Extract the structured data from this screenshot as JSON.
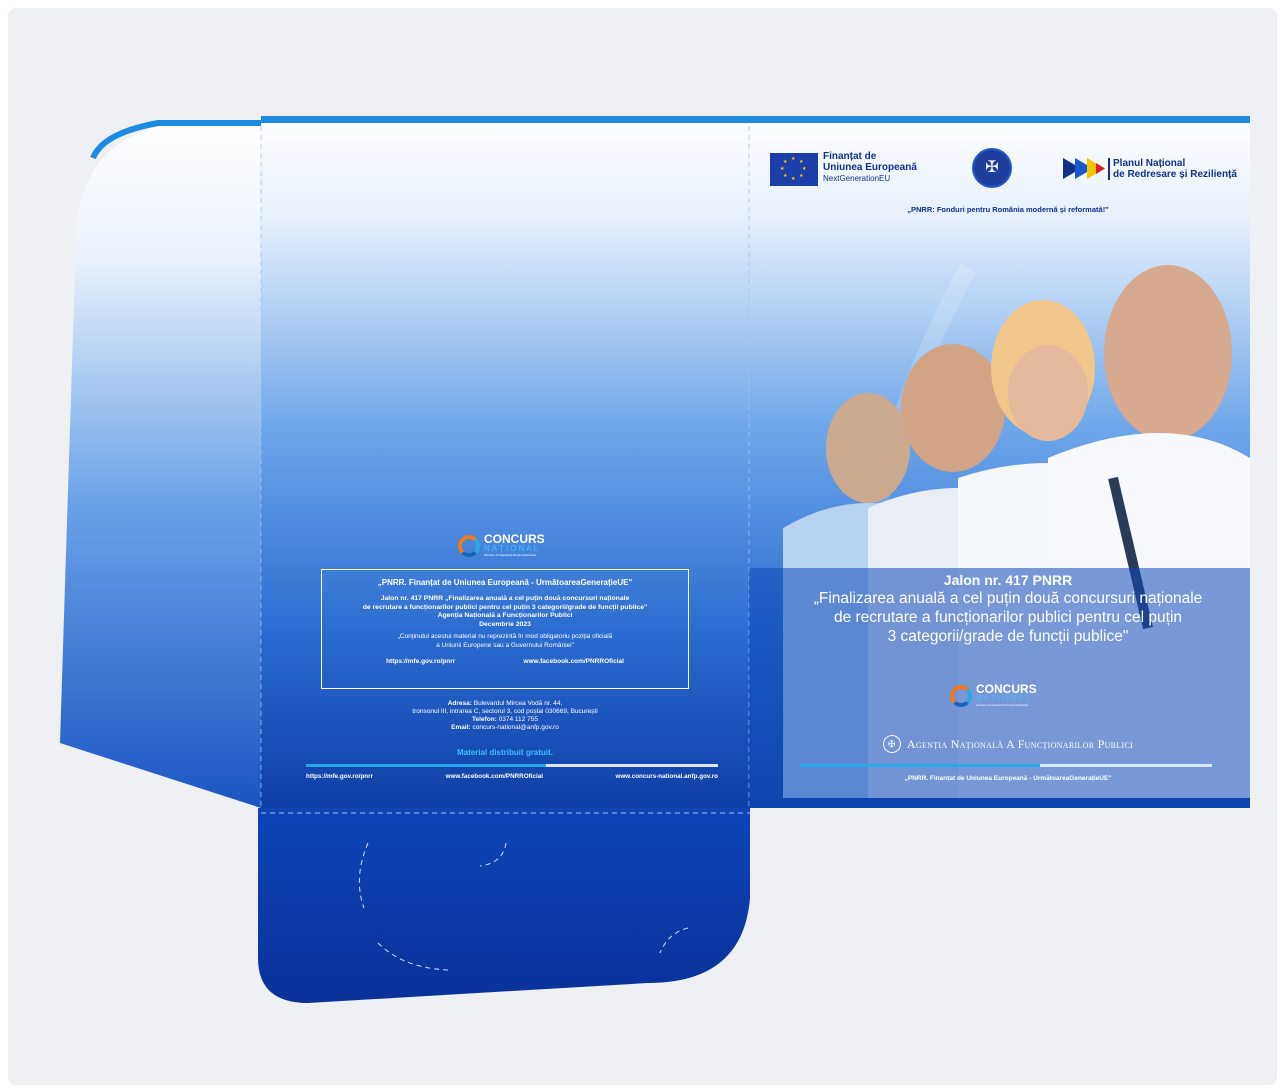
{
  "colors": {
    "background": "#eef0f3",
    "folder_top": "#ffffff",
    "folder_mid": "#4b8de0",
    "folder_bottom": "#0a3aa0",
    "accent_light": "#3fc1ff",
    "accent_dark": "#10308a"
  },
  "header": {
    "eu_line1": "Finanțat de",
    "eu_line2": "Uniunea Europeană",
    "eu_line3": "NextGenerationEU",
    "gov_seal_icon": "romanian-government-seal",
    "pnrr_line1": "Planul Național",
    "pnrr_line2": "de Redresare și Reziliență",
    "slogan": "„PNRR: Fonduri pentru România modernă și reformată!\""
  },
  "cover": {
    "title": "Jalon nr. 417 PNRR",
    "subtitle_line1": "„Finalizarea anuală a cel puțin două concursuri naționale",
    "subtitle_line2": "de recrutare a funcționarilor publici pentru cel puțin",
    "subtitle_line3": "3 categorii/grade de funcții publice\"",
    "agency": "Agenția Națională A Funcționarilor Publici",
    "footer_note": "„PNRR. Finanțat de Uniunea Europeană - UrmătoareaGenerațieUE\""
  },
  "concurs_logo": {
    "word": "CONCURS",
    "sub": "NAȚIONAL",
    "tagline": "Oameni Competenți Pentru România"
  },
  "inside": {
    "box_title": "„PNRR. Finanțat de Uniunea Europeană - UrmătoareaGenerațieUE\"",
    "box_line1": "Jalon nr. 417 PNRR „Finalizarea anuală a cel puțin două concursuri naționale",
    "box_line2": "de recrutare a funcționarilor publici pentru cel puțin 3 categorii/grade de funcții publice\"",
    "box_line3": "Agenția Națională a Funcționarilor Publici",
    "box_line4": "Decembrie 2023",
    "disclaimer1": "„Conținutul acestui material nu reprezintă în mod obligatoriu poziția oficială",
    "disclaimer2": "a Uniunii Europene sau a Guvernului României\"",
    "box_link1": "https://mfe.gov.ro/pnrr",
    "box_link2": "www.facebook.com/PNRROficial",
    "address_label": "Adresa:",
    "address_value": "Bulevardul Mircea Vodă nr. 44,",
    "address_line2": "tronsonul III, intrarea C, sectorul 3, cod poștal 030669, București",
    "phone_label": "Telefon:",
    "phone_value": "0374 112 755",
    "email_label": "Email:",
    "email_value": "concurs-national@anfp.gov.ro",
    "free_note": "Material distribuit gratuit.",
    "footer_link1": "https://mfe.gov.ro/pnrr",
    "footer_link2": "www.facebook.com/PNRROficial",
    "footer_link3": "www.concurs-national.anfp.gov.ro"
  }
}
